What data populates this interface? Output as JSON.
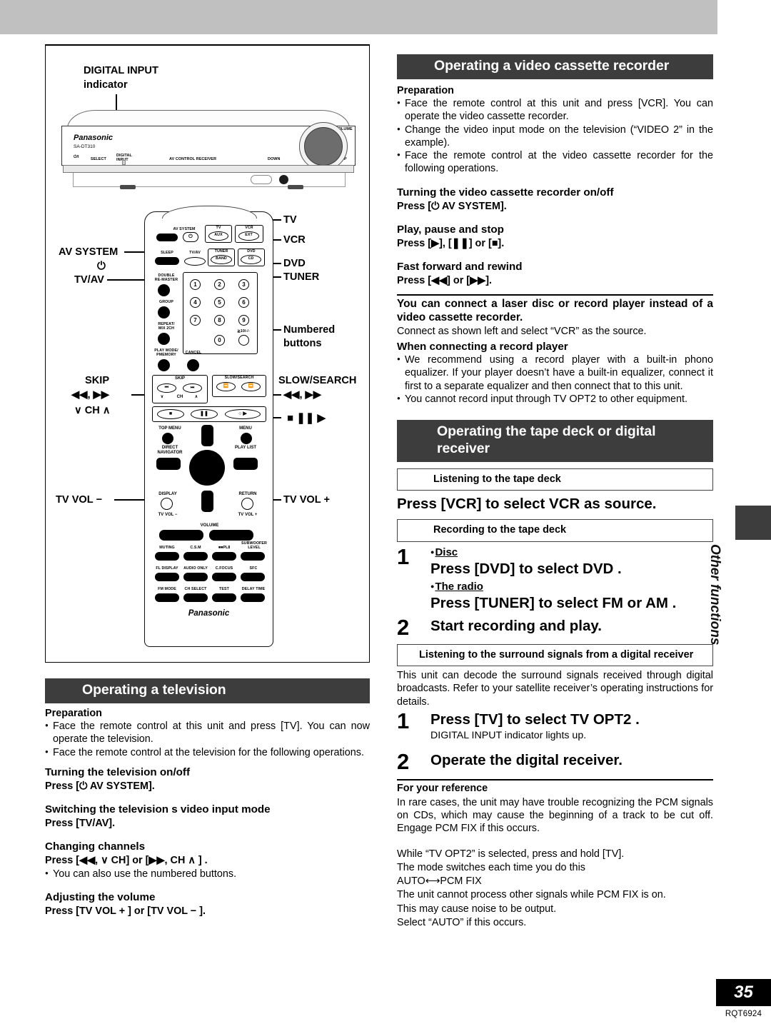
{
  "page": {
    "number": "35",
    "doc_code": "RQT6924"
  },
  "side_tab": {
    "label": "Other functions"
  },
  "figure": {
    "callout_digital_input": "DIGITAL INPUT",
    "callout_digital_input_2": "indicator",
    "receiver": {
      "brand": "Panasonic",
      "model": "SA-DT310",
      "power": "⏻/I",
      "select": "SELECT",
      "digital_input_1": "DIGITAL",
      "digital_input_2": "INPUT",
      "center_text": "AV CONTROL RECEIVER",
      "down": "DOWN",
      "up": "UP",
      "volume": "VOLUME"
    },
    "labels_left": [
      {
        "name": "av-system",
        "text": "AV SYSTEM"
      },
      {
        "name": "power-symbol",
        "text": "⏻"
      },
      {
        "name": "tv-av",
        "text": "TV/AV"
      },
      {
        "name": "skip",
        "text": "SKIP"
      },
      {
        "name": "skip-arrows",
        "text": "◀◀,  ▶▶"
      },
      {
        "name": "ch-updown",
        "text": "∨ CH ∧"
      },
      {
        "name": "tv-vol-minus",
        "text": "TV VOL −"
      }
    ],
    "labels_right": [
      {
        "name": "tv",
        "text": "TV"
      },
      {
        "name": "vcr",
        "text": "VCR"
      },
      {
        "name": "dvd",
        "text": "DVD"
      },
      {
        "name": "tuner",
        "text": "TUNER"
      },
      {
        "name": "numbered-buttons-1",
        "text": "Numbered"
      },
      {
        "name": "numbered-buttons-2",
        "text": "buttons"
      },
      {
        "name": "slow-search",
        "text": "SLOW/SEARCH"
      },
      {
        "name": "slow-search-arrows",
        "text": "◀◀,  ▶▶"
      },
      {
        "name": "transport",
        "text": "■ ❚❚ ▶"
      },
      {
        "name": "tv-vol-plus",
        "text": "TV VOL +"
      }
    ],
    "remote_buttons": {
      "av_system": "AV SYSTEM",
      "tv": "TV",
      "aux": "AUX",
      "vcr": "VCR",
      "ext": "EXT",
      "sleep": "SLEEP",
      "tv_av": "TV/AV",
      "tuner": "TUNER",
      "band": "BAND",
      "dvd": "DVD",
      "cd": "CD",
      "double": "DOUBLE",
      "re_master": "RE-MASTER",
      "group": "GROUP",
      "repeat": "REPEAT/",
      "mix2ch": "MIX 2CH",
      "play_mode": "PLAY MODE/",
      "pmemory": "PMEMORY",
      "cancel": "CANCEL",
      "ten_plus": "≧10/-/-",
      "numbers": [
        "1",
        "2",
        "3",
        "4",
        "5",
        "6",
        "7",
        "8",
        "9",
        "0"
      ],
      "skip": "SKIP",
      "ch": "CH",
      "slow_search": "SLOW/SEARCH",
      "top_menu": "TOP MENU",
      "direct": "DIRECT",
      "navigator": "NAVIGATOR",
      "menu": "MENU",
      "play_list": "PLAY LIST",
      "display": "DISPLAY",
      "tv_vol_minus": "TV VOL −",
      "return": "RETURN",
      "tv_vol_plus": "TV VOL +",
      "volume": "VOLUME",
      "muting": "MUTING",
      "csm": "C.S.M",
      "pl2": "■■PLⅡ",
      "subwoofer": "SUBWOOFER",
      "level": "LEVEL",
      "fl_display": "FL DISPLAY",
      "audio_only": "AUDIO ONLY",
      "cfocus": "C.FOCUS",
      "sfc": "SFC",
      "fm_mode": "FM MODE",
      "ch_select": "CH SELECT",
      "test": "TEST",
      "delay_time": "DELAY TIME",
      "brand": "Panasonic"
    }
  },
  "vcr_section": {
    "title": "Operating a video cassette recorder",
    "prep_heading": "Preparation",
    "prep_bullets": [
      "Face the remote control at this unit and press [VCR]. You can operate the video cassette recorder.",
      "Change the video input mode on the television (“VIDEO 2” in the example).",
      "Face the remote control at the video cassette recorder for the following operations."
    ],
    "sub1_heading": "Turning the video cassette recorder on/off",
    "sub1_text": "Press [⏻ AV SYSTEM].",
    "sub2_heading": "Play, pause and stop",
    "sub2_text": "Press [▶], [❚❚] or [■].",
    "sub3_heading": "Fast forward and rewind",
    "sub3_text": "Press [◀◀] or [▶▶].",
    "note_heading": "You can connect a laser disc or record player instead of a video cassette recorder.",
    "note_text": "Connect as shown left and select “VCR” as the source.",
    "record_heading": "When connecting a record player",
    "record_bullets": [
      "We recommend using a record player with a built-in phono equalizer. If your player doesn’t have a built-in equalizer, connect it first to a separate equalizer and then connect that to this unit.",
      "You cannot record input through TV OPT2 to other equipment."
    ]
  },
  "tv_section": {
    "title": "Operating a television",
    "prep_heading": "Preparation",
    "prep_bullets": [
      "Face the remote control at this unit and press [TV]. You can now operate the television.",
      "Face the remote control at the television for the following operations."
    ],
    "sub1_heading": "Turning the television on/off",
    "sub1_text": "Press [⏻ AV SYSTEM].",
    "sub2_heading": "Switching the television s video input mode",
    "sub2_text": "Press [TV/AV].",
    "sub3_heading": "Changing channels",
    "sub3_text": "Press  [◀◀,  ∨ CH] or [▶▶, CH ∧ ] .",
    "sub3_bullet": "You can also use the numbered buttons.",
    "sub4_heading": "Adjusting the volume",
    "sub4_text": "Press [TV VOL + ] or [TV VOL − ]."
  },
  "tape_section": {
    "title": "Operating the tape deck or digital receiver",
    "listen_box": "Listening to the tape deck",
    "listen_line": "Press [VCR] to select  VCR  as source.",
    "record_box": "Recording to the tape deck",
    "step1_num": "1",
    "step1_bullet_disc": "Disc",
    "step1_disc_line": "Press [DVD] to select  DVD .",
    "step1_bullet_radio": "The radio",
    "step1_radio_line": "Press  [TUNER]  to  select   FM  or  AM .",
    "step2_num": "2",
    "step2_line": "Start recording and play.",
    "surround_box": "Listening to the surround signals from a digital receiver",
    "surround_intro": "This unit can decode the surround signals received through digital broadcasts. Refer to your satellite receiver’s operating instructions for details.",
    "s_step1_num": "1",
    "s_step1_line": "Press [TV] to select  TV OPT2 .",
    "s_step1_note": "DIGITAL INPUT indicator lights up.",
    "s_step2_num": "2",
    "s_step2_line": "Operate the digital receiver.",
    "ref_heading": "For your reference",
    "ref_paragraph_1": "In rare cases, the unit may have trouble recognizing the PCM signals on CDs, which may cause the beginning of a track to be cut off. Engage PCM FIX if this occurs.",
    "ref_lines": [
      "While “TV OPT2” is selected, press and hold [TV].",
      "The mode switches each time you do this",
      "AUTO⟷PCM FIX",
      "The unit cannot process other signals while PCM FIX is on.",
      "This may cause noise to be output.",
      "Select  “AUTO” if this occurs."
    ]
  }
}
